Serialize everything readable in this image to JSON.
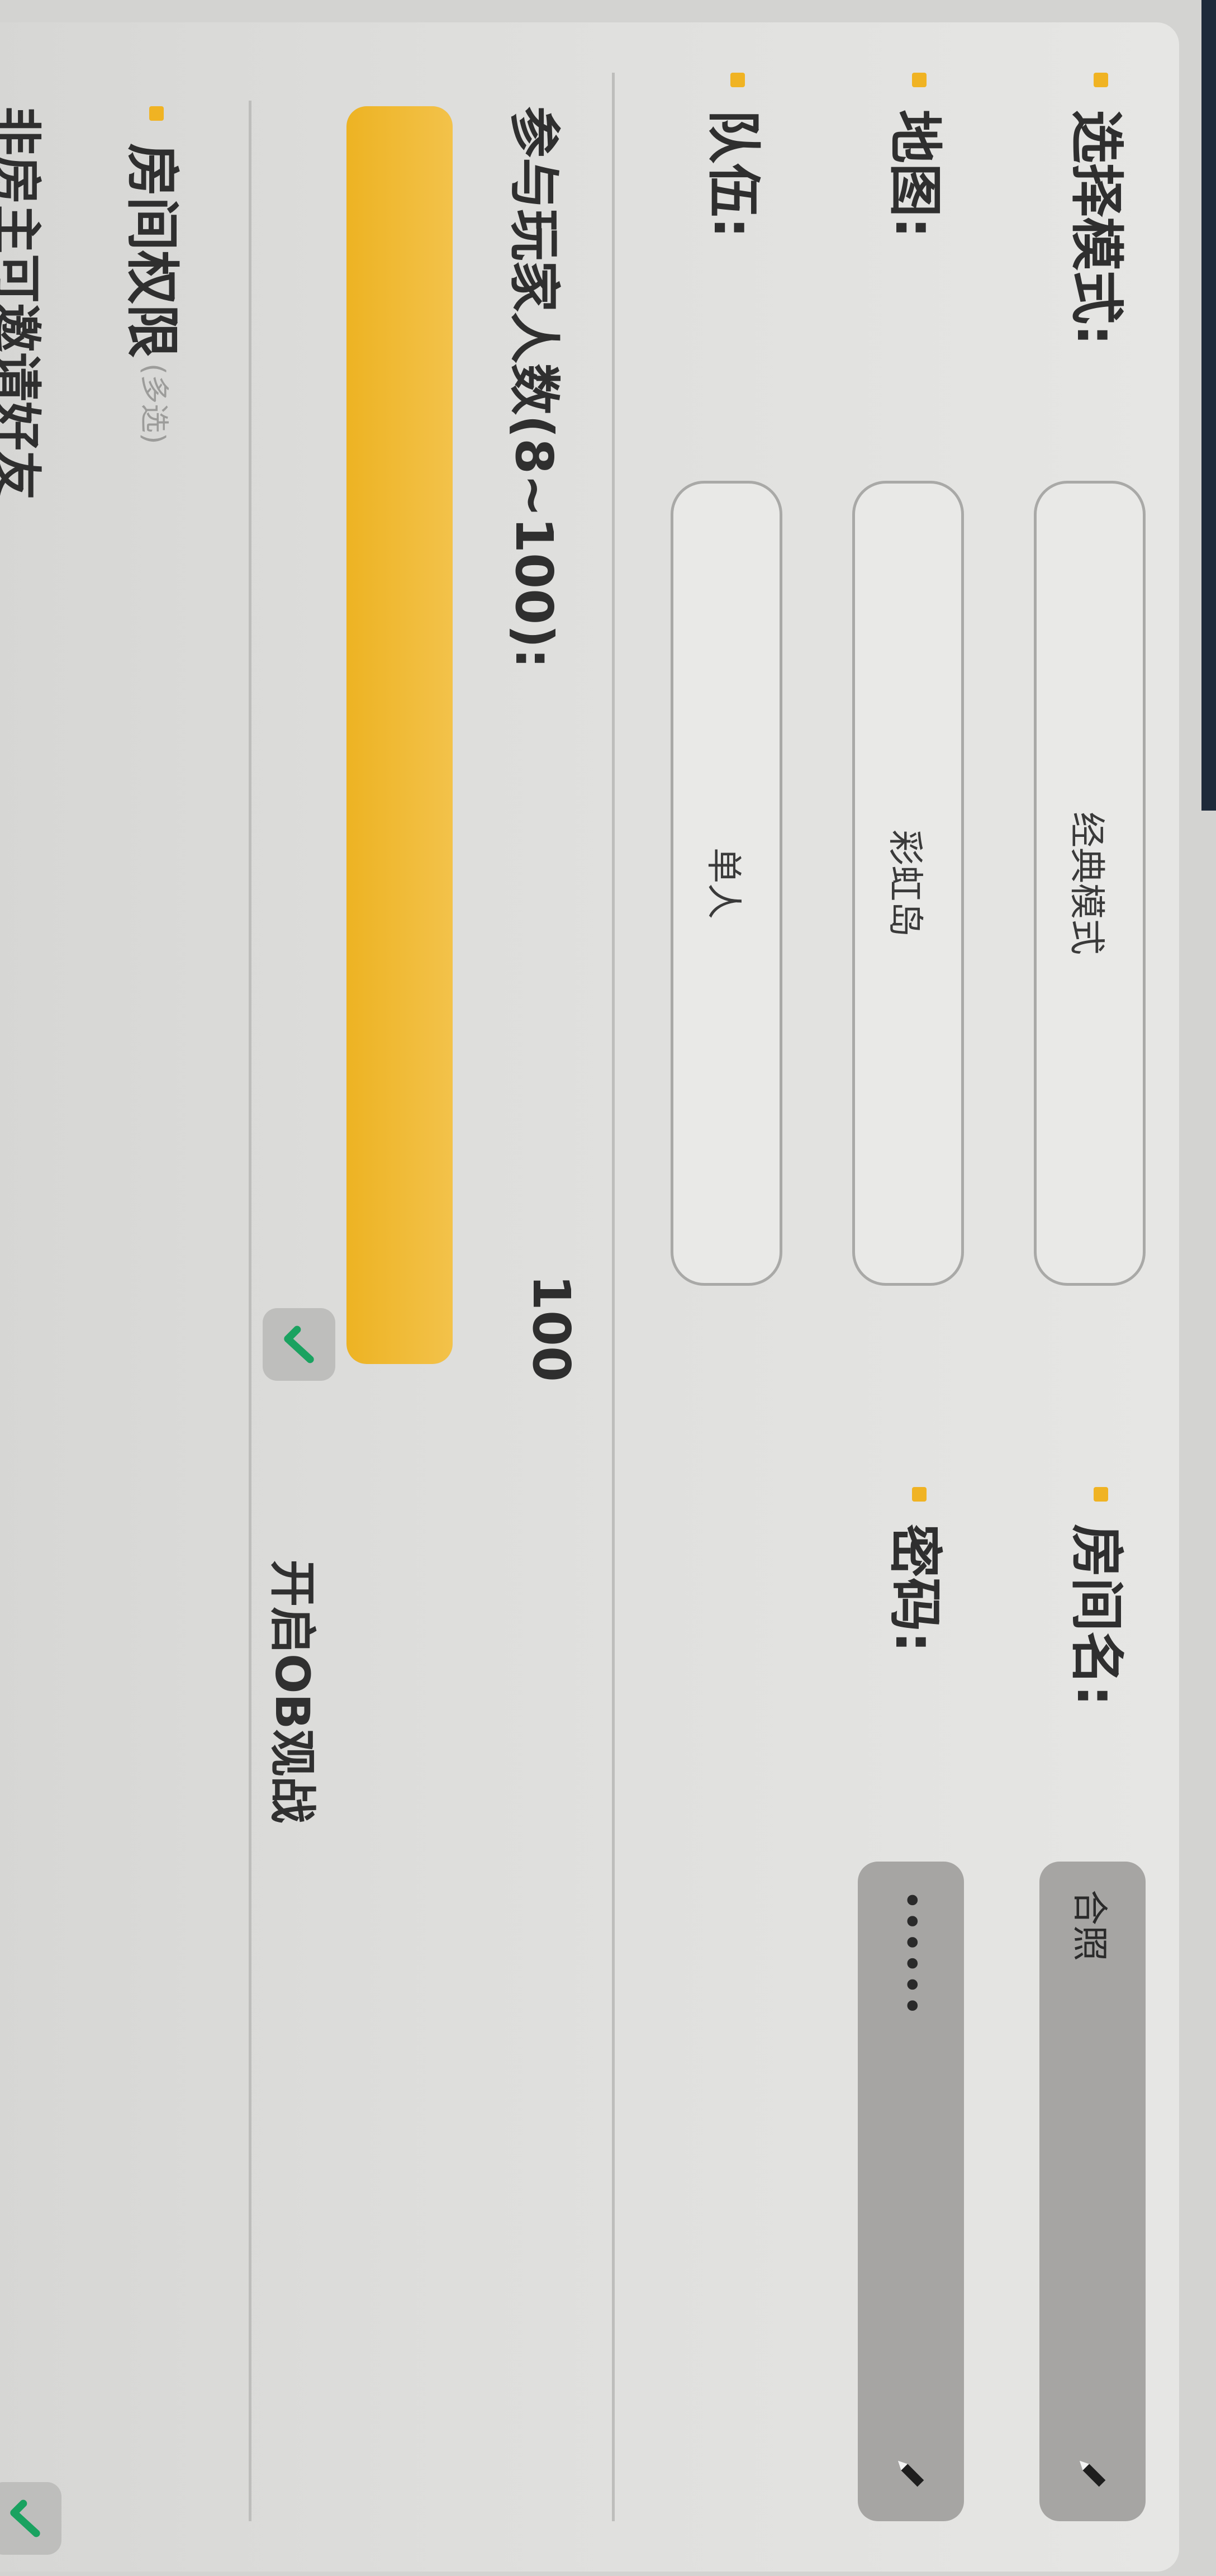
{
  "room_settings": {
    "mode": {
      "label": "选择模式:",
      "value": "经典模式"
    },
    "map": {
      "label": "地图:",
      "value": "彩虹岛"
    },
    "team": {
      "label": "队伍:",
      "value": "单人"
    },
    "room_name": {
      "label": "房间名:",
      "value": "合照"
    },
    "password": {
      "label": "密码:",
      "value": "••••••"
    },
    "player_count": {
      "label": "参与玩家人数(8~100):",
      "value": "100",
      "min": 8,
      "max": 100,
      "current": 100
    },
    "ob_spectate": {
      "label": "开启OB观战",
      "checked": true
    },
    "permissions": {
      "label": "房间权限",
      "sublabel": "(多选)",
      "options": [
        {
          "label": "非房主可邀请好友",
          "checked": true
        }
      ]
    }
  },
  "colors": {
    "accent": "#f0b323",
    "check": "#1aa260"
  },
  "icons": [
    "pencil-icon",
    "checkmark-icon"
  ]
}
